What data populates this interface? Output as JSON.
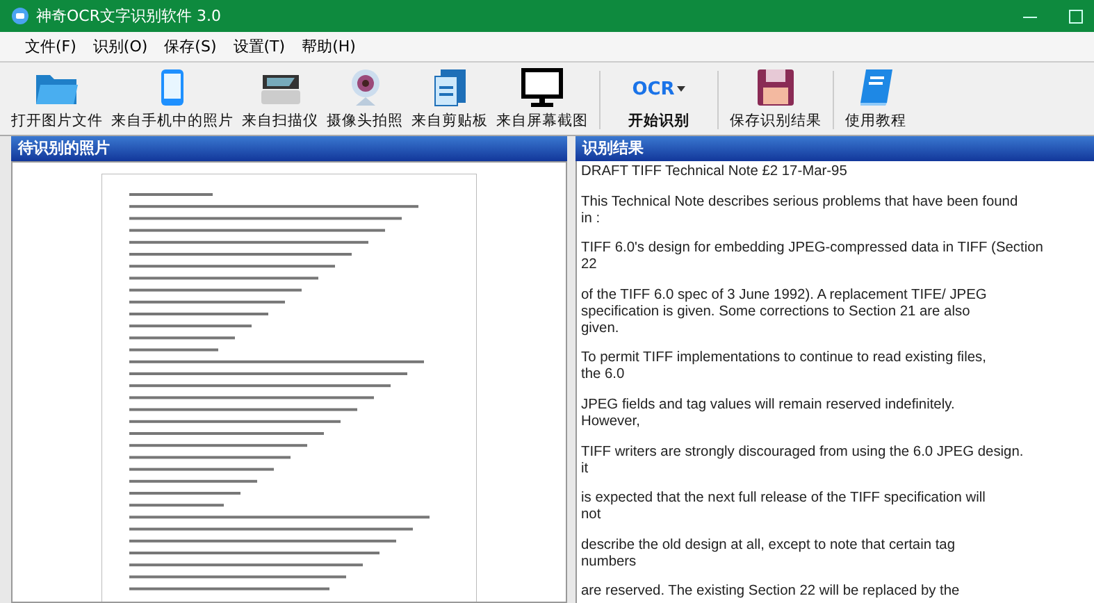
{
  "window": {
    "title": "神奇OCR文字识别软件 3.0"
  },
  "menu": [
    "文件(F)",
    "识别(O)",
    "保存(S)",
    "设置(T)",
    "帮助(H)"
  ],
  "toolbar": [
    [
      {
        "kind": "folder",
        "label": "打开图片文件"
      },
      {
        "kind": "phone",
        "label": "来自手机中的照片"
      },
      {
        "kind": "scanner",
        "label": "来自扫描仪"
      },
      {
        "kind": "webcam",
        "label": "摄像头拍照"
      },
      {
        "kind": "clipboard",
        "label": "来自剪贴板"
      },
      {
        "kind": "monitor",
        "label": "来自屏幕截图"
      }
    ],
    [
      {
        "kind": "ocr",
        "label": "开始识别",
        "icon_text": "OCR"
      }
    ],
    [
      {
        "kind": "floppy",
        "label": "保存识别结果"
      }
    ],
    [
      {
        "kind": "book",
        "label": "使用教程"
      }
    ]
  ],
  "image_panel": {
    "title": "待识别的照片"
  },
  "result_panel": {
    "title": "识别结果",
    "paragraphs": [
      [
        "DRAFT TIFF Technical Note £2 17-Mar-95"
      ],
      [
        "This Technical Note describes serious problems that have been found",
        "in :"
      ],
      [
        "TIFF 6.0's design for embedding JPEG-compressed data in TIFF (Section",
        "22"
      ],
      [
        "of the TIFF 6.0 spec of 3 June 1992). A replacement TIFE/ JPEG",
        "specification is given. Some corrections to Section 21 are also",
        "given."
      ],
      [
        "To permit TIFF implementations to continue to read existing files,",
        "the 6.0"
      ],
      [
        "JPEG fields and tag values will remain reserved indefinitely.",
        "However,"
      ],
      [
        "TIFF writers are strongly discouraged from using the 6.0 JPEG design.",
        "it"
      ],
      [
        "is expected that the next full release of the TIFF specification will",
        "not"
      ],
      [
        "describe the old design at all, except to note that certain tag",
        "numbers"
      ],
      [
        "are reserved. The existing Section 22 will be replaced by the"
      ]
    ]
  }
}
